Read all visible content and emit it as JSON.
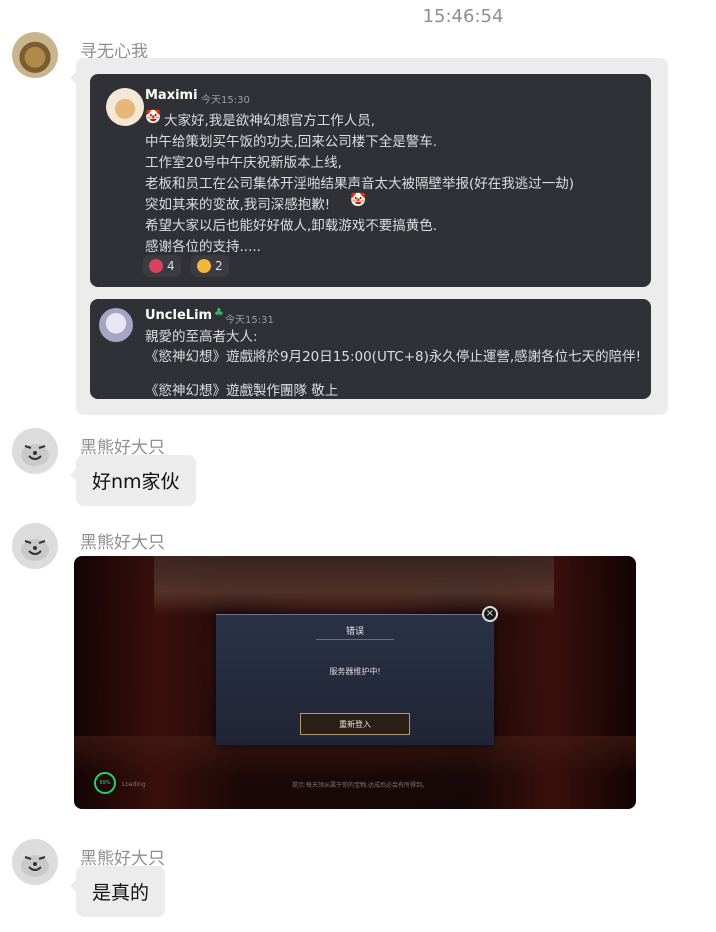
{
  "timestamp": "15:46:54",
  "messages": [
    {
      "sender": "寻无心我",
      "quoted": {
        "post1": {
          "name": "Maximi",
          "time": "今天15:30",
          "lines": [
            "大家好,我是欲神幻想官方工作人员,",
            "中午给策划买午饭的功夫,回来公司楼下全是警车.",
            "工作室20号中午庆祝新版本上线,",
            "老板和员工在公司集体开淫啪结果声音太大被隔壁举报(好在我逃过一劫)",
            "突如其来的变故,我司深感抱歉!",
            "希望大家以后也能好好做人,卸载游戏不要搞黄色.",
            "感谢各位的支持....."
          ],
          "reactions": [
            "4",
            "2"
          ]
        },
        "post2": {
          "name": "UncleLim",
          "time": "今天15:31",
          "lines": [
            "親愛的至高者大人:",
            "《慾神幻想》遊戲將於9月20日15:00(UTC+8)永久停止運營,感謝各位七天的陪伴!",
            "",
            "《慾神幻想》遊戲製作團隊 敬上"
          ]
        }
      }
    },
    {
      "sender": "黑熊好大只",
      "text": "好nm家伙"
    },
    {
      "sender": "黑熊好大只",
      "game": {
        "dialog_title": "错误",
        "dialog_message": "服务器维护中!",
        "button_label": "重新登入",
        "loading_percent": "89%",
        "loading_label": "Loading",
        "tip": "提示:每天领从属于你的宝物,达成后必会有所得到。"
      }
    },
    {
      "sender": "黑熊好大只",
      "text": "是真的"
    }
  ],
  "colors": {
    "chat_bg": "#ffffff",
    "bubble": "#ececec",
    "discord_card": "#2f3136",
    "sender_gray": "#8f8f8f"
  }
}
